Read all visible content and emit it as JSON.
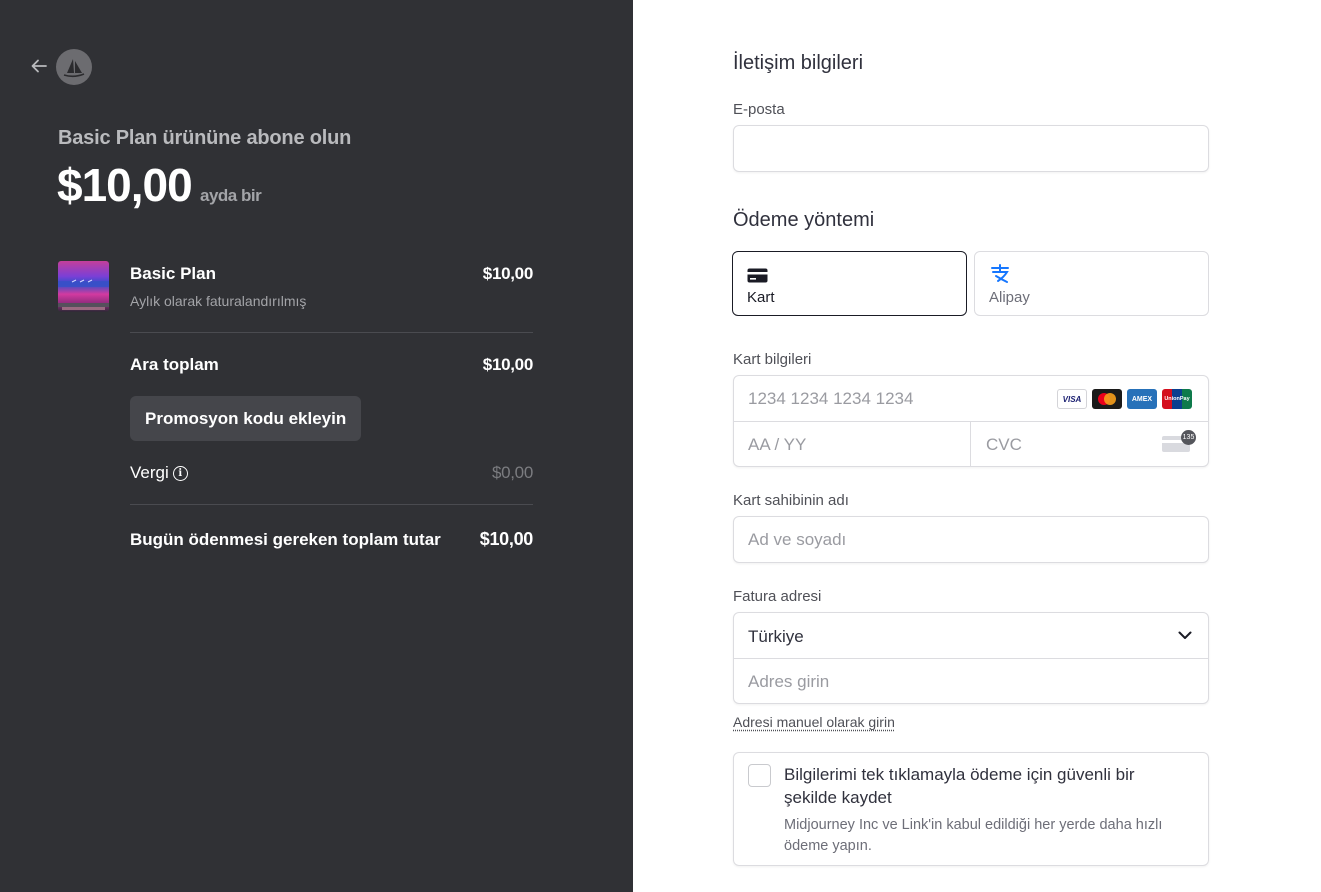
{
  "summary": {
    "subscribe_title": "Basic Plan ürününe abone olun",
    "price": "$10,00",
    "period": "ayda bir",
    "item": {
      "name": "Basic Plan",
      "billing": "Aylık olarak faturalandırılmış",
      "amount": "$10,00"
    },
    "subtotal_label": "Ara toplam",
    "subtotal_amount": "$10,00",
    "promo_label": "Promosyon kodu ekleyin",
    "tax_label": "Vergi",
    "tax_amount": "$0,00",
    "total_label": "Bugün ödenmesi gereken toplam tutar",
    "total_amount": "$10,00"
  },
  "contact": {
    "title": "İletişim bilgileri",
    "email_label": "E-posta",
    "email_value": ""
  },
  "payment": {
    "title": "Ödeme yöntemi",
    "methods": [
      {
        "label": "Kart",
        "icon": "card-icon",
        "selected": true
      },
      {
        "label": "Alipay",
        "icon": "alipay-icon",
        "selected": false
      }
    ],
    "card_label": "Kart bilgileri",
    "card_number_placeholder": "1234 1234 1234 1234",
    "card_brands": [
      "VISA",
      "Mastercard",
      "AMEX",
      "UnionPay"
    ],
    "expiry_placeholder": "AA / YY",
    "cvc_placeholder": "CVC",
    "cvc_icon_text": "135",
    "holder_label": "Kart sahibinin adı",
    "holder_placeholder": "Ad ve soyadı",
    "billing_label": "Fatura adresi",
    "country": "Türkiye",
    "address_placeholder": "Adres girin",
    "manual_address_link": "Adresi manuel olarak girin",
    "save_title": "Bilgilerimi tek tıklamayla ödeme için güvenli bir şekilde kaydet",
    "save_desc": "Midjourney Inc ve Link'in kabul edildiği her yerde daha hızlı ödeme yapın."
  },
  "colors": {
    "left_bg": "#303135",
    "accent_alipay": "#1677ff",
    "text_dark": "#30313d"
  }
}
